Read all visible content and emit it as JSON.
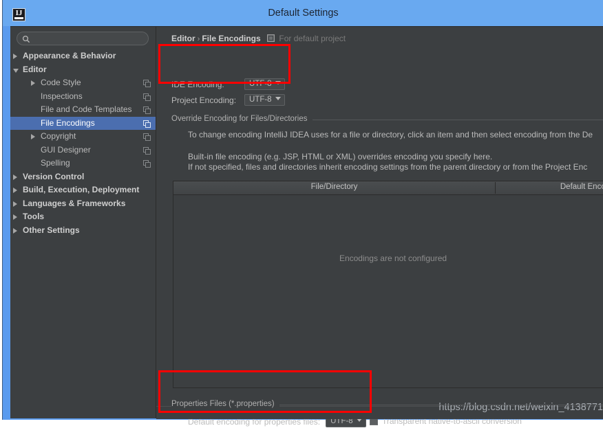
{
  "window": {
    "title": "Default Settings",
    "logo_text": "IJ",
    "logo_icon": "intellij-idea-icon"
  },
  "sidebar": {
    "search": {
      "value": "",
      "placeholder": "",
      "icon": "search-icon"
    },
    "tree": [
      {
        "label": "Appearance & Behavior",
        "indent": 18,
        "arrow": "collapsed",
        "bold": true,
        "copy_icon": false,
        "selected": false
      },
      {
        "label": "Editor",
        "indent": 18,
        "arrow": "expanded",
        "bold": true,
        "copy_icon": false,
        "selected": false
      },
      {
        "label": "Code Style",
        "indent": 44,
        "arrow": "collapsed",
        "bold": false,
        "copy_icon": true,
        "selected": false
      },
      {
        "label": "Inspections",
        "indent": 44,
        "arrow": "none",
        "bold": false,
        "copy_icon": true,
        "selected": false
      },
      {
        "label": "File and Code Templates",
        "indent": 44,
        "arrow": "none",
        "bold": false,
        "copy_icon": true,
        "selected": false
      },
      {
        "label": "File Encodings",
        "indent": 44,
        "arrow": "none",
        "bold": false,
        "copy_icon": true,
        "selected": true
      },
      {
        "label": "Copyright",
        "indent": 44,
        "arrow": "collapsed",
        "bold": false,
        "copy_icon": true,
        "selected": false
      },
      {
        "label": "GUI Designer",
        "indent": 44,
        "arrow": "none",
        "bold": false,
        "copy_icon": true,
        "selected": false
      },
      {
        "label": "Spelling",
        "indent": 44,
        "arrow": "none",
        "bold": false,
        "copy_icon": true,
        "selected": false
      },
      {
        "label": "Version Control",
        "indent": 18,
        "arrow": "collapsed",
        "bold": true,
        "copy_icon": false,
        "selected": false
      },
      {
        "label": "Build, Execution, Deployment",
        "indent": 18,
        "arrow": "collapsed",
        "bold": true,
        "copy_icon": false,
        "selected": false
      },
      {
        "label": "Languages & Frameworks",
        "indent": 18,
        "arrow": "collapsed",
        "bold": true,
        "copy_icon": false,
        "selected": false
      },
      {
        "label": "Tools",
        "indent": 18,
        "arrow": "collapsed",
        "bold": true,
        "copy_icon": false,
        "selected": false
      },
      {
        "label": "Other Settings",
        "indent": 18,
        "arrow": "collapsed",
        "bold": true,
        "copy_icon": false,
        "selected": false
      }
    ]
  },
  "panel": {
    "breadcrumb": {
      "parent": "Editor",
      "separator": "›",
      "current": "File Encodings",
      "scope_icon": "project-scope-icon",
      "scope_text": "For default project"
    },
    "ide_encoding": {
      "label": "IDE Encoding:",
      "value": "UTF-8"
    },
    "project_encoding": {
      "label": "Project Encoding:",
      "value": "UTF-8"
    },
    "override_group_title": "Override Encoding for Files/Directories",
    "description_lines": [
      "To change encoding IntelliJ IDEA uses for a file or directory, click an item and then select encoding from the De",
      "Built-in file encoding (e.g. JSP, HTML or XML) overrides encoding you specify here.",
      "If not specified, files and directories inherit encoding settings from the parent directory or from the Project Enc"
    ],
    "table": {
      "columns": [
        "File/Directory",
        "Default Encod"
      ],
      "rows": [],
      "empty_text": "Encodings are not configured"
    },
    "properties_group_title": "Properties Files (*.properties)",
    "properties_encoding": {
      "label": "Default encoding for properties files:",
      "value": "UTF-8"
    },
    "native_ascii": {
      "label": "Transparent native-to-ascii conversion",
      "checked": false
    }
  },
  "watermark": {
    "text": "https://blog.csdn.net/weixin_4138771"
  },
  "colors": {
    "title_bar": "#69a9f0",
    "frame": "#5a9bee",
    "panel_bg": "#3c3f41",
    "selection": "#4b6eaf",
    "text": "#bbbbbb",
    "annotation": "#ff0000"
  }
}
